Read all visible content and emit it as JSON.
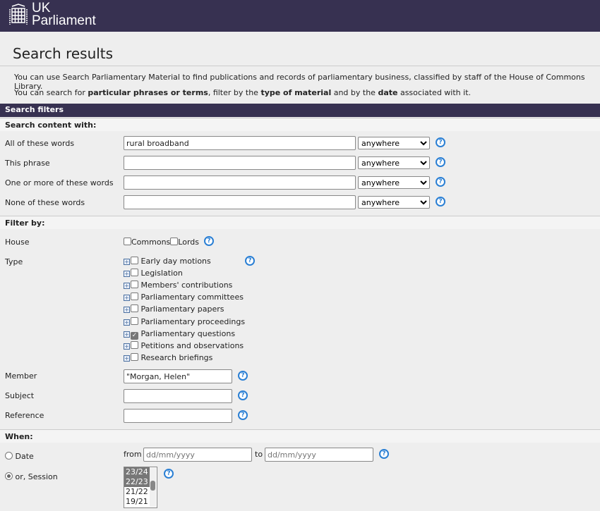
{
  "header": {
    "logo_line1": "UK",
    "logo_line2": "Parliament"
  },
  "page_title": "Search results",
  "intro": {
    "line1": "You can use Search Parliamentary Material to find publications and records of parliamentary business, classified by staff of the House of Commons Library.",
    "line2_a": "You can search for ",
    "line2_b": "particular phrases or terms",
    "line2_c": ", filter by the ",
    "line2_d": "type of material",
    "line2_e": " and by the ",
    "line2_f": "date",
    "line2_g": " associated with it."
  },
  "filters_title": "Search filters",
  "content_section": {
    "title": "Search content with:",
    "rows": [
      {
        "label": "All of these words",
        "value": "rural broadband",
        "scope": "anywhere"
      },
      {
        "label": "This phrase",
        "value": "",
        "scope": "anywhere"
      },
      {
        "label": "One or more of these words",
        "value": "",
        "scope": "anywhere"
      },
      {
        "label": "None of these words",
        "value": "",
        "scope": "anywhere"
      }
    ]
  },
  "filter_section": {
    "title": "Filter by:",
    "house_label": "House",
    "house": [
      {
        "label": "Commons",
        "checked": false
      },
      {
        "label": "Lords",
        "checked": false
      }
    ],
    "type_label": "Type",
    "types": [
      {
        "label": "Early day motions",
        "checked": false
      },
      {
        "label": "Legislation",
        "checked": false
      },
      {
        "label": "Members' contributions",
        "checked": false
      },
      {
        "label": "Parliamentary committees",
        "checked": false
      },
      {
        "label": "Parliamentary papers",
        "checked": false
      },
      {
        "label": "Parliamentary proceedings",
        "checked": false
      },
      {
        "label": "Parliamentary questions",
        "checked": true
      },
      {
        "label": "Petitions and observations",
        "checked": false
      },
      {
        "label": "Research briefings",
        "checked": false
      }
    ],
    "member_label": "Member",
    "member_value": "\"Morgan, Helen\"",
    "subject_label": "Subject",
    "subject_value": "",
    "reference_label": "Reference",
    "reference_value": ""
  },
  "when_section": {
    "title": "When:",
    "date_label": "Date",
    "from_label": "from",
    "to_label": "to",
    "date_placeholder": "dd/mm/yyyy",
    "session_label": "or, Session",
    "session_selected": true,
    "sessions": [
      {
        "label": "23/24",
        "selected": true
      },
      {
        "label": "22/23",
        "selected": true
      },
      {
        "label": "21/22",
        "selected": false
      },
      {
        "label": "19/21",
        "selected": false
      }
    ]
  },
  "help_symbol": "?"
}
